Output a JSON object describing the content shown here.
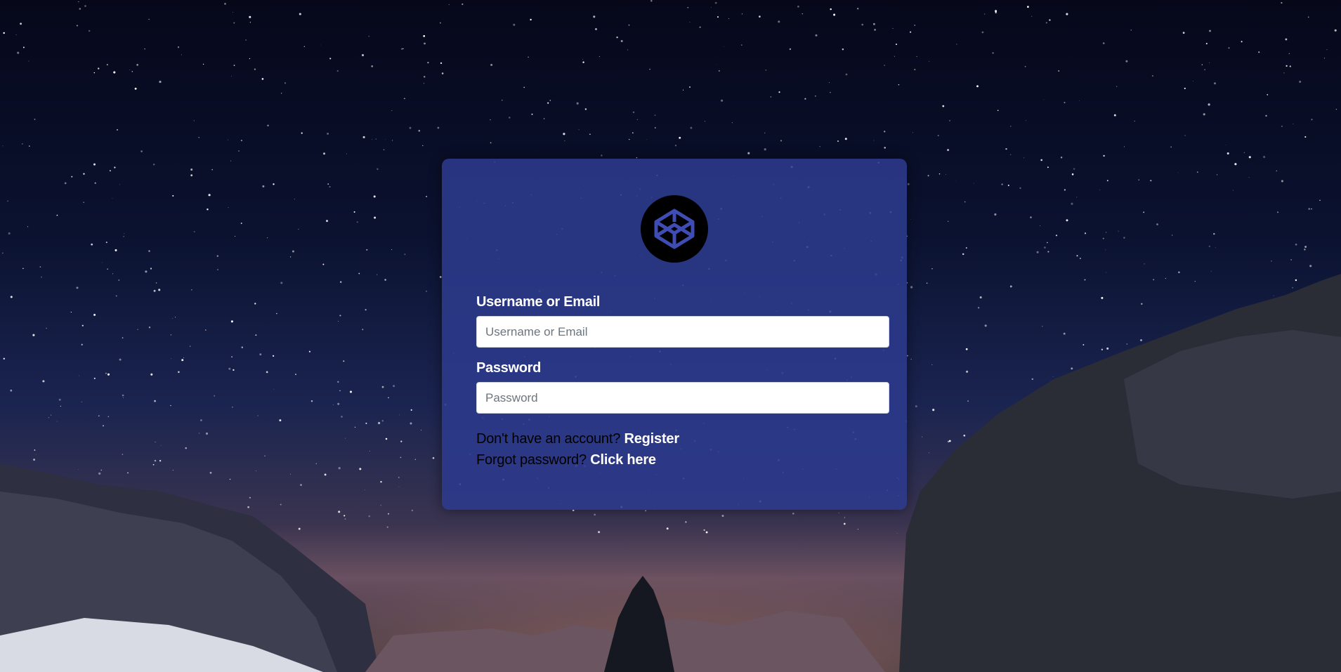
{
  "login": {
    "username_label": "Username or Email",
    "username_placeholder": "Username or Email",
    "password_label": "Password",
    "password_placeholder": "Password",
    "register_prompt": "Don't have an account?",
    "register_link": "Register",
    "forgot_prompt": "Forgot password?",
    "forgot_link": "Click here"
  },
  "logo": {
    "icon": "codepen-icon",
    "color": "#3f4cb4",
    "background": "#000000"
  },
  "colors": {
    "card": "#2c3a8c",
    "label": "#ffffff",
    "link": "#ffffff"
  }
}
